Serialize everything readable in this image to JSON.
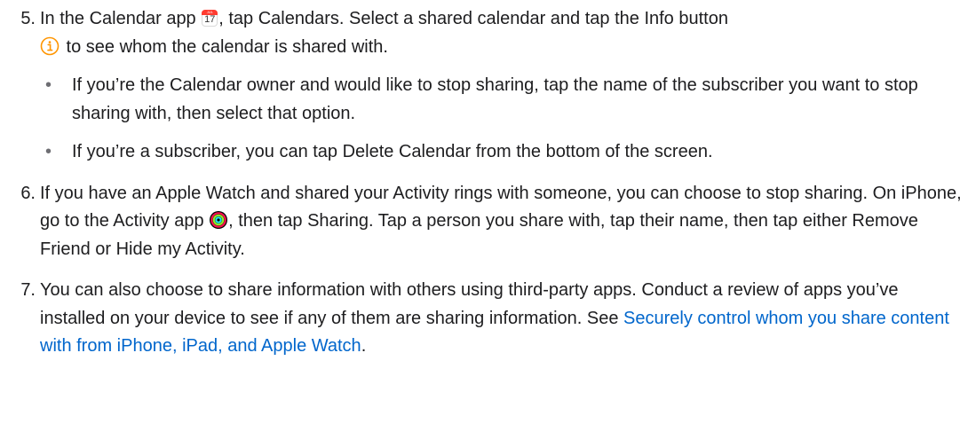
{
  "steps": [
    {
      "number": "5.",
      "text_a": "In the Calendar app ",
      "cal_icon_month": "JUL",
      "cal_icon_day": "17",
      "text_b": ", tap Calendars. Select a shared calendar and tap the Info button",
      "text_c": " to see whom the calendar is shared with.",
      "bullets": [
        "If you’re the Calendar owner and would like to stop sharing, tap the name of the subscriber you want to stop sharing with, then select that option.",
        "If you’re a subscriber, you can tap Delete Calendar from the bottom of the screen."
      ],
      "bullet_marker": "•"
    },
    {
      "number": "6.",
      "text_a": "If you have an Apple Watch and shared your Activity rings with someone, you can choose to stop sharing. On iPhone, go to the Activity app ",
      "text_b": ", then tap Sharing. Tap a person you share with, tap their name, then tap either Remove Friend or Hide my Activity."
    },
    {
      "number": "7.",
      "text_a": "You can also choose to share information with others using third-party apps. Conduct a review of apps you’ve installed on your device to see if any of them are sharing information. See ",
      "link_text": "Securely control whom you share content with from iPhone, iPad, and Apple Watch",
      "text_b": "."
    }
  ],
  "icons": {
    "calendar": "calendar-app-icon",
    "info": "info-icon",
    "activity": "activity-app-icon"
  },
  "colors": {
    "text": "#1d1d1f",
    "link": "#0066cc",
    "info_icon": "#ff9500",
    "calendar_red": "#ff3b30",
    "ring_move": "#fa114f",
    "ring_exercise": "#92e82a",
    "ring_stand": "#1eeaef"
  }
}
